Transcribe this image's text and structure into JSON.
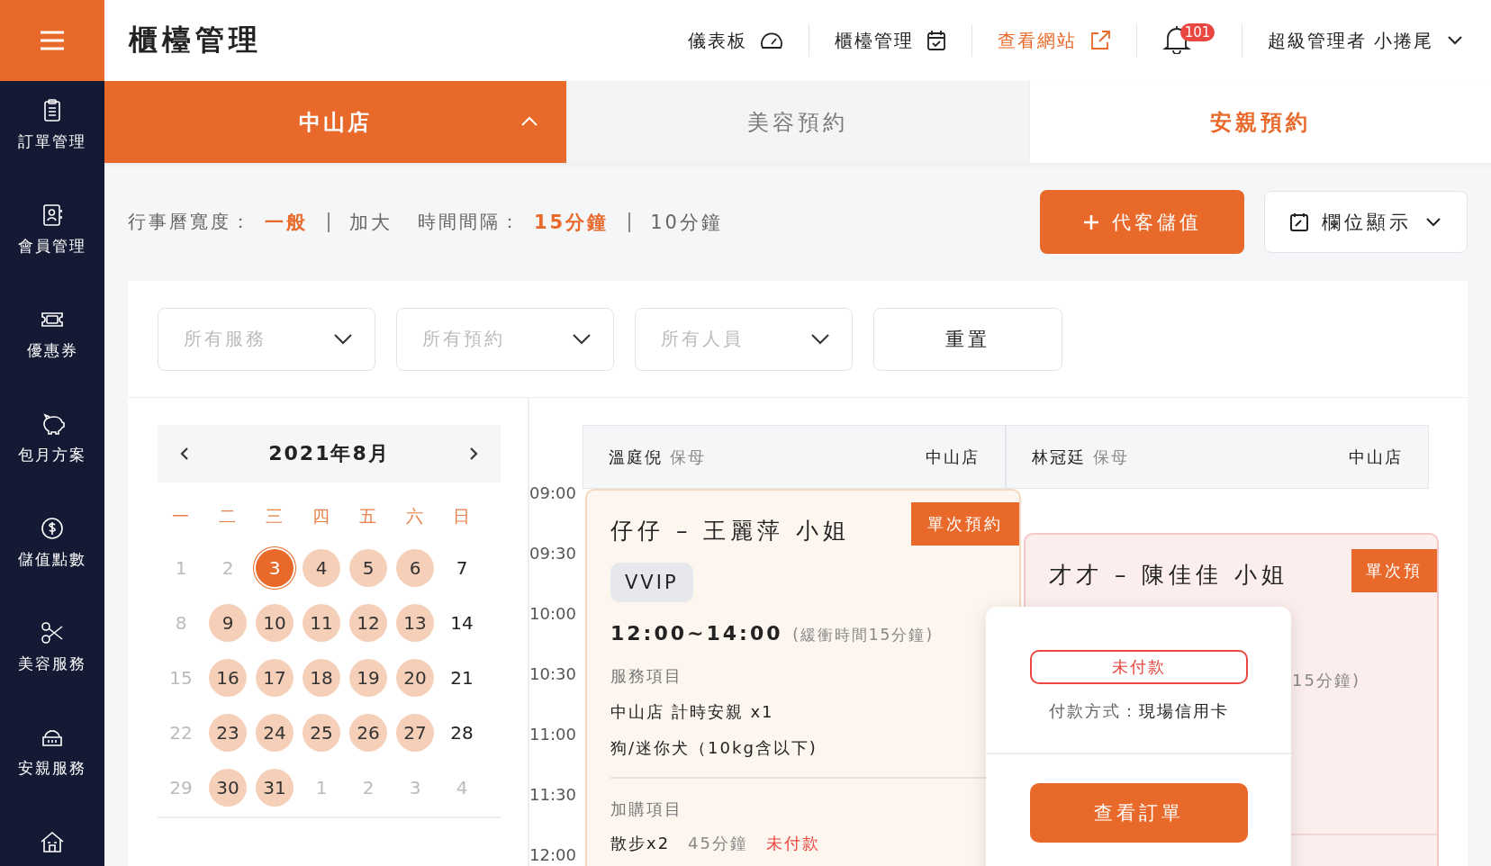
{
  "header": {
    "title": "櫃檯管理",
    "nav": [
      {
        "label": "儀表板",
        "kind": "dashboard"
      },
      {
        "label": "櫃檯管理",
        "kind": "calendar"
      },
      {
        "label": "查看網站",
        "kind": "external"
      }
    ],
    "notifications": "101",
    "user": "超級管理者 小捲尾"
  },
  "sidebar": {
    "items": [
      {
        "label": "訂單管理",
        "kind": "clipboard"
      },
      {
        "label": "會員管理",
        "kind": "contact"
      },
      {
        "label": "優惠券",
        "kind": "ticket"
      },
      {
        "label": "包月方案",
        "kind": "piggy"
      },
      {
        "label": "儲值點數",
        "kind": "coin"
      },
      {
        "label": "美容服務",
        "kind": "scissors"
      },
      {
        "label": "安親服務",
        "kind": "carrier"
      },
      {
        "kind": "house"
      }
    ]
  },
  "store": {
    "label": "中山店",
    "expanded": true
  },
  "tabs": [
    {
      "label": "美容預約",
      "selected": false
    },
    {
      "label": "安親預約",
      "selected": true
    }
  ],
  "toolbar": {
    "width_label": "行事曆寬度：",
    "width_options": [
      {
        "label": "一般",
        "selected": true
      },
      {
        "label": "加大",
        "selected": false
      }
    ],
    "interval_label": "時間間隔：",
    "interval_options": [
      {
        "label": "15分鐘",
        "selected": true
      },
      {
        "label": "10分鐘",
        "selected": false
      }
    ],
    "add_button": "代客儲值",
    "columns_button": "欄位顯示"
  },
  "filters": [
    {
      "placeholder": "所有服務"
    },
    {
      "placeholder": "所有預約"
    },
    {
      "placeholder": "所有人員"
    }
  ],
  "reset_button": "重置",
  "calendar": {
    "title": "2021年8月",
    "weekdays": [
      "一",
      "二",
      "三",
      "四",
      "五",
      "六",
      "日"
    ],
    "days": [
      {
        "label": "1",
        "kind": "muted",
        "selected": false
      },
      {
        "label": "2",
        "kind": "muted",
        "selected": false
      },
      {
        "label": "3",
        "kind": "booked",
        "selected": true
      },
      {
        "label": "4",
        "kind": "booked",
        "selected": false
      },
      {
        "label": "5",
        "kind": "booked",
        "selected": false
      },
      {
        "label": "6",
        "kind": "booked",
        "selected": false
      },
      {
        "label": "7",
        "kind": "plain",
        "selected": false
      },
      {
        "label": "8",
        "kind": "muted",
        "selected": false
      },
      {
        "label": "9",
        "kind": "booked",
        "selected": false
      },
      {
        "label": "10",
        "kind": "booked",
        "selected": false
      },
      {
        "label": "11",
        "kind": "booked",
        "selected": false
      },
      {
        "label": "12",
        "kind": "booked",
        "selected": false
      },
      {
        "label": "13",
        "kind": "booked",
        "selected": false
      },
      {
        "label": "14",
        "kind": "plain",
        "selected": false
      },
      {
        "label": "15",
        "kind": "muted",
        "selected": false
      },
      {
        "label": "16",
        "kind": "booked",
        "selected": false
      },
      {
        "label": "17",
        "kind": "booked",
        "selected": false
      },
      {
        "label": "18",
        "kind": "booked",
        "selected": false
      },
      {
        "label": "19",
        "kind": "booked",
        "selected": false
      },
      {
        "label": "20",
        "kind": "booked",
        "selected": false
      },
      {
        "label": "21",
        "kind": "plain",
        "selected": false
      },
      {
        "label": "22",
        "kind": "muted",
        "selected": false
      },
      {
        "label": "23",
        "kind": "booked",
        "selected": false
      },
      {
        "label": "24",
        "kind": "booked",
        "selected": false
      },
      {
        "label": "25",
        "kind": "booked",
        "selected": false
      },
      {
        "label": "26",
        "kind": "booked",
        "selected": false
      },
      {
        "label": "27",
        "kind": "booked",
        "selected": false
      },
      {
        "label": "28",
        "kind": "plain",
        "selected": false
      },
      {
        "label": "29",
        "kind": "muted",
        "selected": false
      },
      {
        "label": "30",
        "kind": "booked",
        "selected": false
      },
      {
        "label": "31",
        "kind": "booked",
        "selected": false
      },
      {
        "label": "1",
        "kind": "muted",
        "selected": false
      },
      {
        "label": "2",
        "kind": "muted",
        "selected": false
      },
      {
        "label": "3",
        "kind": "muted",
        "selected": false
      },
      {
        "label": "4",
        "kind": "muted",
        "selected": false
      }
    ]
  },
  "schedule": {
    "times": [
      "09:00",
      "09:30",
      "10:00",
      "10:30",
      "11:00",
      "11:30",
      "12:00"
    ],
    "columns": [
      {
        "staff": "溫庭倪",
        "role": "保母",
        "store": "中山店"
      },
      {
        "staff": "林冠廷",
        "role": "保母",
        "store": "中山店"
      }
    ],
    "bookings": [
      {
        "title": "仔仔 – 王麗萍 小姐",
        "badge": "單次預約",
        "color": "#fdf6ef",
        "tag": "VVIP",
        "time": "12:00~14:00",
        "buffer": "(緩衝時間15分鐘)",
        "services_label": "服務項目",
        "services": [
          "中山店 計時安親 x1",
          "狗/迷你犬（10kg含以下)"
        ],
        "addons_label": "加購項目",
        "addons": [
          {
            "name": "散步x2",
            "duration": "45分鐘",
            "status": "未付款"
          }
        ]
      },
      {
        "title": "才才 – 陳佳佳 小姐",
        "badge": "單次預",
        "color": "#fdeeee",
        "buffer": "15分鐘)"
      }
    ]
  },
  "popup": {
    "status": "未付款",
    "payment_label": "付款方式：",
    "payment_method": "現場信用卡",
    "button": "查看訂單"
  }
}
